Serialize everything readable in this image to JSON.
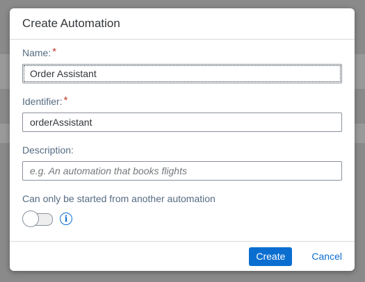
{
  "dialog": {
    "title": "Create Automation"
  },
  "form": {
    "name": {
      "label": "Name:",
      "required_mark": "*",
      "value": "Order Assistant"
    },
    "identifier": {
      "label": "Identifier:",
      "required_mark": "*",
      "value": "orderAssistant"
    },
    "description": {
      "label": "Description:",
      "placeholder": "e.g. An automation that books flights"
    },
    "start_option": {
      "label": "Can only be started from another automation",
      "enabled": false,
      "info_icon": "info-icon"
    }
  },
  "footer": {
    "create_label": "Create",
    "cancel_label": "Cancel"
  },
  "colors": {
    "accent": "#0a6ed1",
    "required": "#c0392b"
  }
}
